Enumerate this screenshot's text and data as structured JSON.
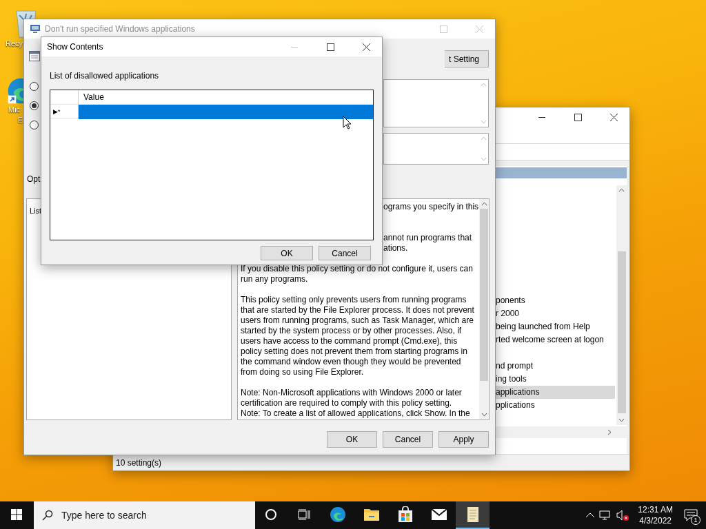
{
  "desktop_icons": [
    {
      "kind": "recycle",
      "lines": [
        "Recy"
      ]
    },
    {
      "kind": "edge",
      "lines": [
        "Mic",
        "E"
      ]
    }
  ],
  "back_window": {
    "list_items": [
      {
        "kind": "text",
        "text": "ponents",
        "selected": false
      },
      {
        "kind": "text",
        "text": "r 2000",
        "selected": false
      },
      {
        "kind": "text",
        "text": "being launched from Help",
        "selected": false
      },
      {
        "kind": "text",
        "text": "rted welcome screen at logon",
        "selected": false
      },
      {
        "kind": "blank"
      },
      {
        "kind": "text",
        "text": "nd prompt",
        "selected": false
      },
      {
        "kind": "text",
        "text": "ing tools",
        "selected": false
      },
      {
        "kind": "text",
        "text": "applications",
        "selected": true
      },
      {
        "kind": "text",
        "text": "pplications",
        "selected": false
      }
    ],
    "status": "10 setting(s)"
  },
  "policy_dialog": {
    "title": "Don't run specified Windows applications",
    "active": false,
    "setting_button": "t Setting",
    "radios": [
      {
        "selected": false
      },
      {
        "selected": true
      },
      {
        "selected": false
      }
    ],
    "options_label": "Opt",
    "options_text": "List",
    "help_lines": [
      {
        "kind": "partial",
        "text": "ograms you specify in this"
      },
      {
        "kind": "blank"
      },
      {
        "kind": "blank"
      },
      {
        "kind": "partial",
        "text": "annot run programs that"
      },
      {
        "kind": "partial",
        "text": "ations."
      },
      {
        "kind": "blank"
      },
      {
        "kind": "full",
        "text": "If you disable this policy setting or do not configure it, users can"
      },
      {
        "kind": "full",
        "text": "run any programs."
      },
      {
        "kind": "blank"
      },
      {
        "kind": "full",
        "text": "This policy setting only prevents users from running programs"
      },
      {
        "kind": "full",
        "text": "that are started by the File Explorer process. It does not prevent"
      },
      {
        "kind": "full",
        "text": "users from running programs, such as Task Manager, which are"
      },
      {
        "kind": "full",
        "text": "started by the system process or by other processes.  Also, if"
      },
      {
        "kind": "full",
        "text": "users have access to the command prompt (Cmd.exe), this"
      },
      {
        "kind": "full",
        "text": "policy setting does not prevent them from starting programs in"
      },
      {
        "kind": "full",
        "text": "the command window even though they would be prevented"
      },
      {
        "kind": "full",
        "text": "from doing so using File Explorer."
      },
      {
        "kind": "blank"
      },
      {
        "kind": "full",
        "text": "Note: Non-Microsoft applications with Windows 2000 or later"
      },
      {
        "kind": "full",
        "text": "certification are required to comply with this policy setting."
      },
      {
        "kind": "full",
        "text": "Note: To create a list of allowed applications, click Show.  In the"
      }
    ],
    "buttons": [
      "OK",
      "Cancel",
      "Apply"
    ]
  },
  "show_contents": {
    "title": "Show Contents",
    "label": "List of disallowed applications",
    "column": "Value",
    "rows": [
      {
        "marker": "▶*",
        "selected": true
      }
    ],
    "buttons": [
      "OK",
      "Cancel"
    ]
  },
  "taskbar": {
    "search_placeholder": "Type here to search",
    "apps": [
      {
        "kind": "edge",
        "active": false
      },
      {
        "kind": "folder",
        "active": false
      },
      {
        "kind": "store",
        "active": false
      },
      {
        "kind": "mail",
        "active": false
      },
      {
        "kind": "notepad",
        "active": true
      }
    ],
    "time": "12:31 AM",
    "date": "4/3/2022",
    "notifications": "1"
  }
}
